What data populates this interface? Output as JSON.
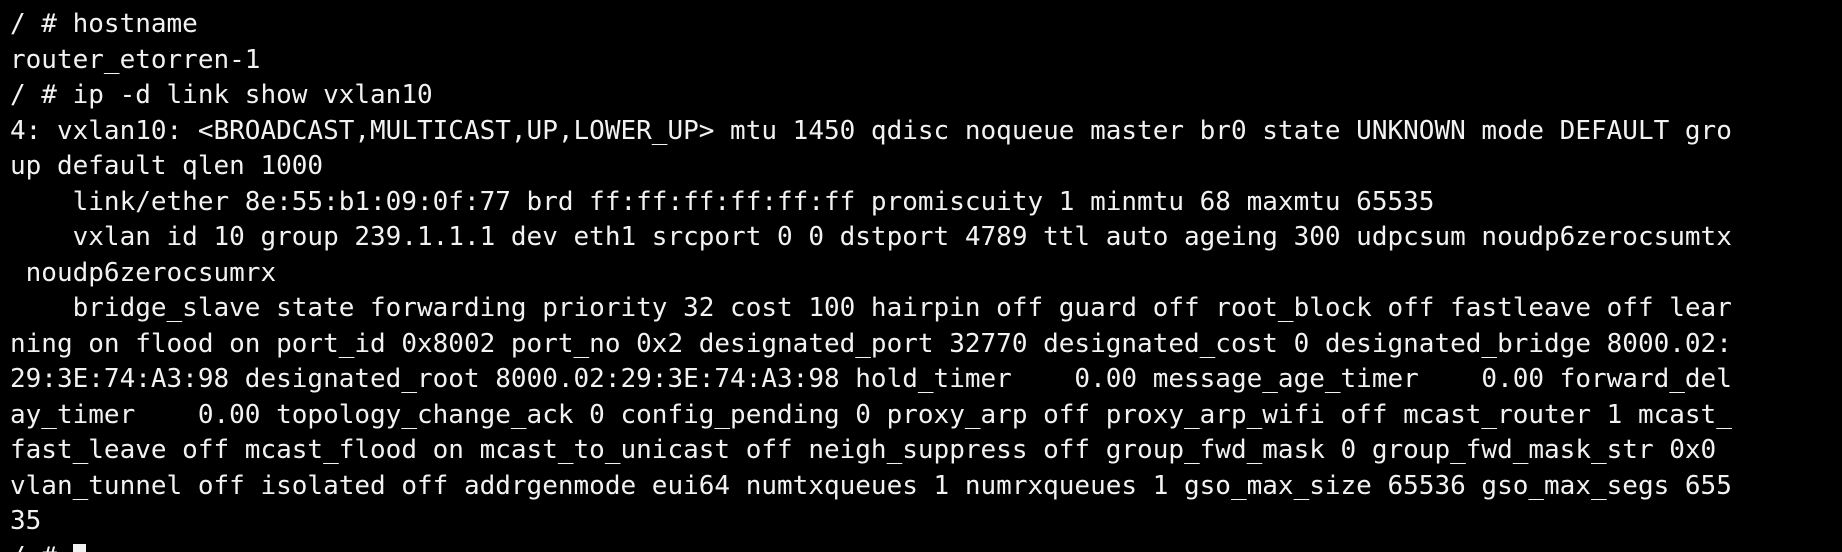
{
  "terminal": {
    "lines": [
      "/ # hostname",
      "router_etorren-1",
      "/ # ip -d link show vxlan10",
      "4: vxlan10: <BROADCAST,MULTICAST,UP,LOWER_UP> mtu 1450 qdisc noqueue master br0 state UNKNOWN mode DEFAULT gro",
      "up default qlen 1000",
      "    link/ether 8e:55:b1:09:0f:77 brd ff:ff:ff:ff:ff:ff promiscuity 1 minmtu 68 maxmtu 65535",
      "    vxlan id 10 group 239.1.1.1 dev eth1 srcport 0 0 dstport 4789 ttl auto ageing 300 udpcsum noudp6zerocsumtx",
      " noudp6zerocsumrx",
      "    bridge_slave state forwarding priority 32 cost 100 hairpin off guard off root_block off fastleave off lear",
      "ning on flood on port_id 0x8002 port_no 0x2 designated_port 32770 designated_cost 0 designated_bridge 8000.02:",
      "29:3E:74:A3:98 designated_root 8000.02:29:3E:74:A3:98 hold_timer    0.00 message_age_timer    0.00 forward_del",
      "ay_timer    0.00 topology_change_ack 0 config_pending 0 proxy_arp off proxy_arp_wifi off mcast_router 1 mcast_",
      "fast_leave off mcast_flood on mcast_to_unicast off neigh_suppress off group_fwd_mask 0 group_fwd_mask_str 0x0",
      "vlan_tunnel off isolated off addrgenmode eui64 numtxqueues 1 numrxqueues 1 gso_max_size 65536 gso_max_segs 655",
      "35"
    ],
    "prompt": "/ # "
  }
}
